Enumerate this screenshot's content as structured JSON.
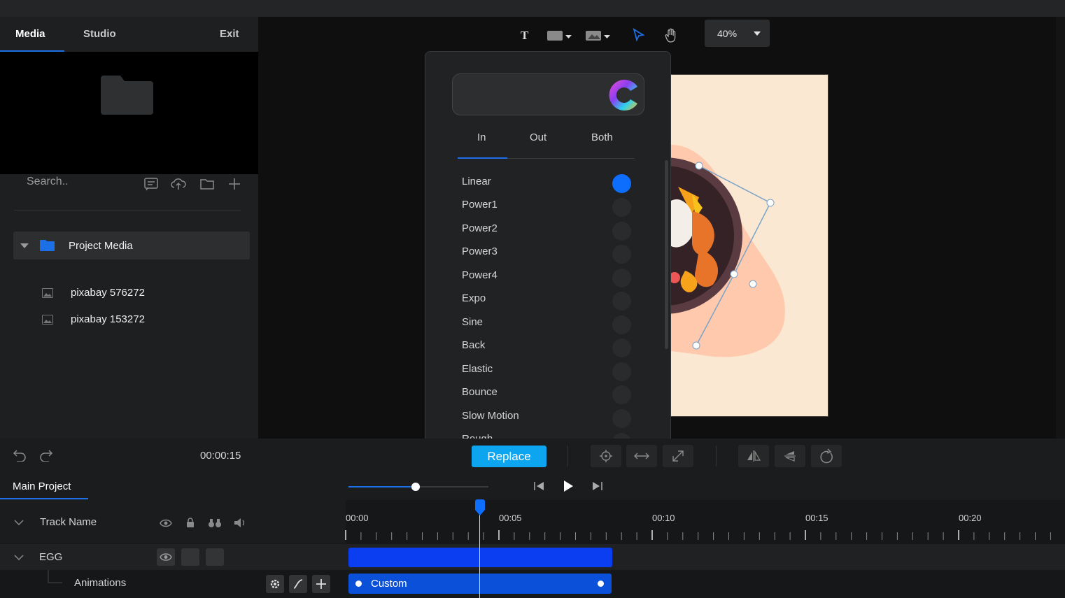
{
  "left_panel": {
    "tabs": [
      "Media",
      "Studio"
    ],
    "exit_label": "Exit",
    "search_placeholder": "Search..",
    "project_media_label": "Project Media",
    "media_items": [
      "pixabay 576272",
      "pixabay 153272"
    ]
  },
  "toolbar": {
    "text_tool_glyph": "T",
    "zoom_label": "40%"
  },
  "easing_menu": {
    "tabs": [
      "In",
      "Out",
      "Both"
    ],
    "active_tab": "In",
    "options": [
      "Linear",
      "Power1",
      "Power2",
      "Power3",
      "Power4",
      "Expo",
      "Sine",
      "Back",
      "Elastic",
      "Bounce",
      "Slow Motion",
      "Rough"
    ],
    "selected": "Linear",
    "accent": "#0d6efd"
  },
  "controls": {
    "time": "00:00:15",
    "replace_label": "Replace"
  },
  "timeline": {
    "project_tab": "Main Project",
    "header_track_label": "Track Name",
    "track_name": "EGG",
    "sub_track_label": "Animations",
    "clip_label": "Custom",
    "ruler_labels": [
      "00:00",
      "00:05",
      "00:10",
      "00:15",
      "00:20"
    ],
    "clip_color": "#0a3ef0"
  }
}
